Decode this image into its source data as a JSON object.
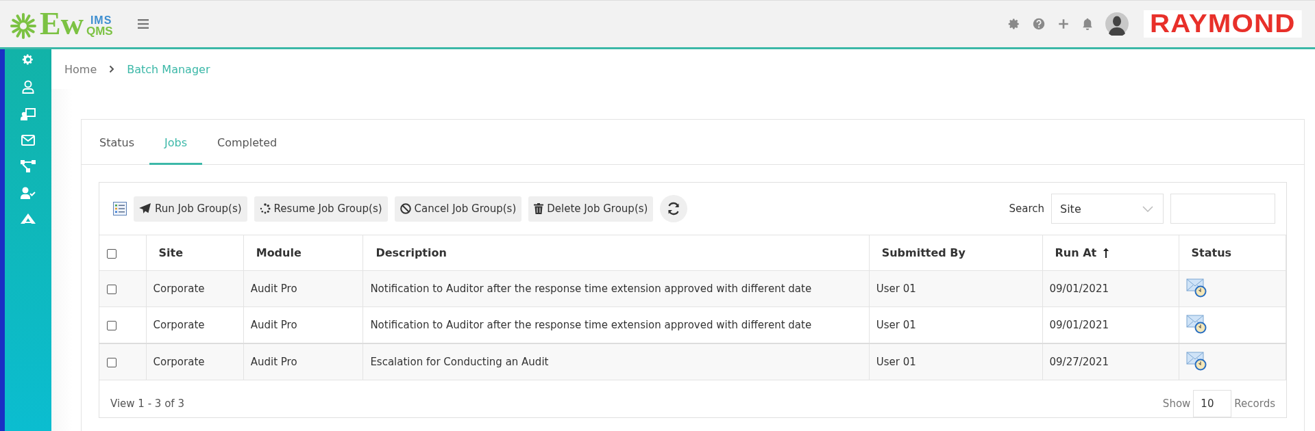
{
  "header": {
    "logo": {
      "main": "Ew",
      "upper": "IMS",
      "lower": "QMS"
    },
    "brand": "RAYMOND"
  },
  "breadcrumb": [
    "Home",
    "Batch Manager"
  ],
  "tabs": [
    {
      "label": "Status",
      "selected": false
    },
    {
      "label": "Jobs",
      "selected": true
    },
    {
      "label": "Completed",
      "selected": false
    }
  ],
  "toolbar": {
    "buttons": [
      {
        "kind": "run",
        "label": "Run Job Group(s)"
      },
      {
        "kind": "resume",
        "label": "Resume Job Group(s)"
      },
      {
        "kind": "cancel",
        "label": "Cancel Job Group(s)"
      },
      {
        "kind": "delete",
        "label": "Delete Job Group(s)"
      }
    ],
    "search": {
      "label": "Search",
      "field": "Site"
    }
  },
  "table": {
    "select_all": {
      "checked": false
    },
    "columns": [
      {
        "label": "Site"
      },
      {
        "label": "Module"
      },
      {
        "label": "Description"
      },
      {
        "label": "Submitted By"
      },
      {
        "label": "Run At",
        "kind": "sorted-ascending"
      },
      {
        "label": "Status"
      }
    ],
    "rows": [
      {
        "checked": false,
        "site": "Corporate",
        "module": "Audit Pro",
        "description": "Notification to Auditor after the response time extension approved with different date",
        "submitted_by": "User 01",
        "run_at": "09/01/2021",
        "kind": "scheduled"
      },
      {
        "checked": false,
        "site": "Corporate",
        "module": "Audit Pro",
        "description": "Notification to Auditor after the response time extension approved with different date",
        "submitted_by": "User 01",
        "run_at": "09/01/2021",
        "kind": "scheduled"
      },
      {
        "checked": false,
        "site": "Corporate",
        "module": "Audit Pro",
        "description": "Escalation for Conducting an Audit",
        "submitted_by": "User 01",
        "run_at": "09/27/2021",
        "kind": "scheduled"
      }
    ]
  },
  "footer": {
    "summary": "View 1 - 3 of 3",
    "show_label": "Show",
    "page_size": "10",
    "records_label": "Records"
  }
}
